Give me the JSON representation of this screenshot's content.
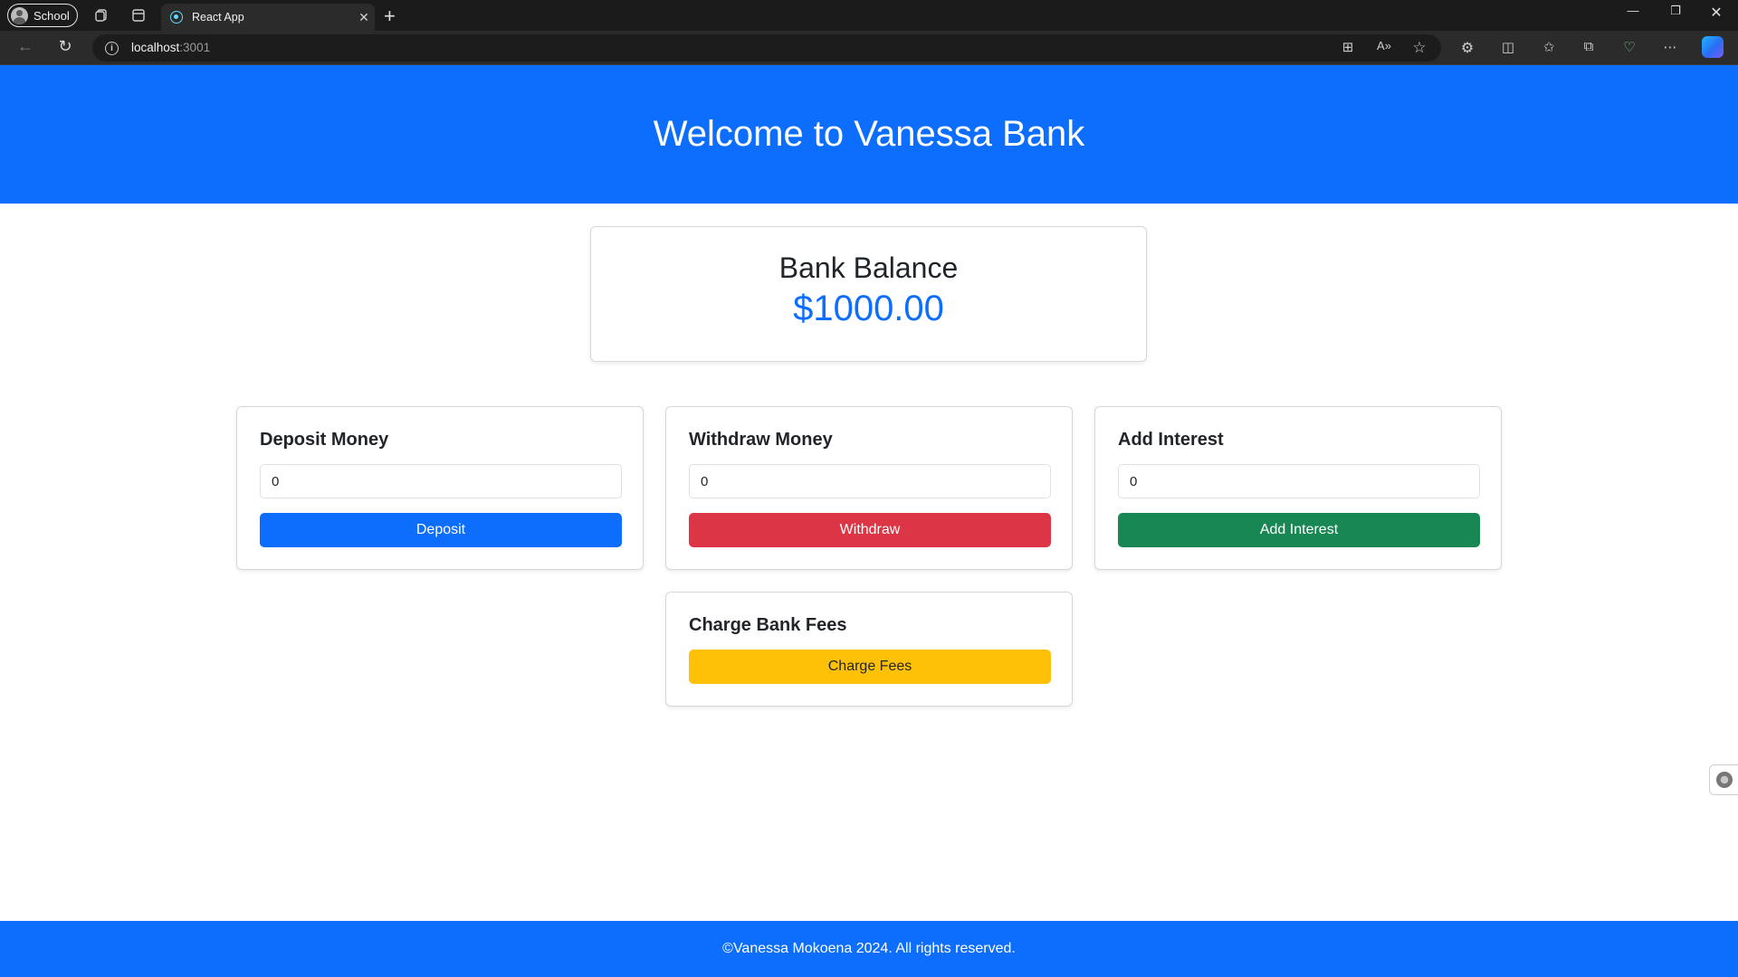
{
  "browser": {
    "profile_label": "School",
    "tab_title": "React App",
    "url_host": "localhost",
    "url_port": ":3001",
    "icons": [
      "workspaces-icon",
      "tab-actions-icon",
      "back-icon",
      "refresh-icon",
      "site-info-icon",
      "app-available-icon",
      "read-aloud-icon",
      "favorite-star-icon",
      "extensions-icon",
      "split-screen-icon",
      "favorites-icon",
      "collections-icon",
      "browser-essentials-icon",
      "more-icon",
      "copilot-icon"
    ]
  },
  "header": {
    "title": "Welcome to Vanessa Bank"
  },
  "balance": {
    "title": "Bank Balance",
    "amount": "$1000.00"
  },
  "deposit": {
    "title": "Deposit Money",
    "value": "0",
    "button": "Deposit",
    "color": "#0d6efd"
  },
  "withdraw": {
    "title": "Withdraw Money",
    "value": "0",
    "button": "Withdraw",
    "color": "#dc3545"
  },
  "interest": {
    "title": "Add Interest",
    "value": "0",
    "button": "Add Interest",
    "color": "#198754"
  },
  "fees": {
    "title": "Charge Bank Fees",
    "button": "Charge Fees",
    "color": "#ffc107"
  },
  "footer": {
    "text": "©Vanessa Mokoena 2024. All rights reserved."
  }
}
